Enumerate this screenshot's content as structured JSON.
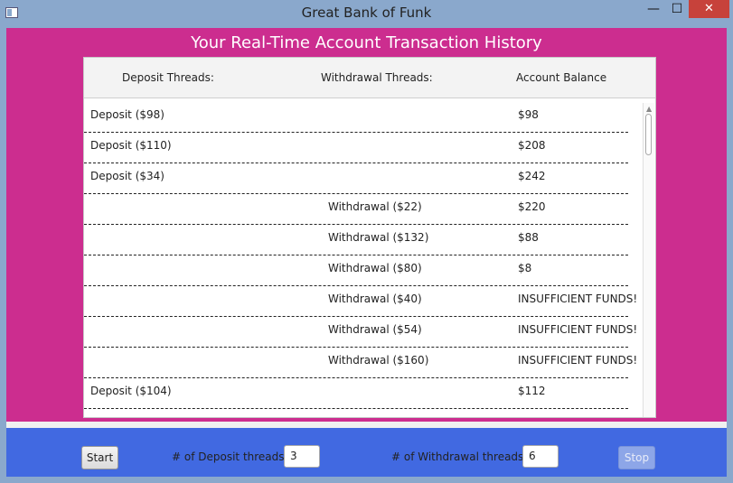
{
  "window": {
    "title": "Great Bank of Funk",
    "minimize": "—",
    "maximize": "☐",
    "close": "✕"
  },
  "heading": "Your Real-Time Account Transaction History",
  "table": {
    "columns": [
      "Deposit Threads:",
      "Withdrawal Threads:",
      "Account Balance"
    ],
    "rows": [
      {
        "deposit": "Deposit ($98)",
        "withdrawal": "",
        "balance": "$98"
      },
      {
        "deposit": "Deposit ($110)",
        "withdrawal": "",
        "balance": "$208"
      },
      {
        "deposit": "Deposit ($34)",
        "withdrawal": "",
        "balance": "$242"
      },
      {
        "deposit": "",
        "withdrawal": "Withdrawal ($22)",
        "balance": "$220"
      },
      {
        "deposit": "",
        "withdrawal": "Withdrawal ($132)",
        "balance": "$88"
      },
      {
        "deposit": "",
        "withdrawal": "Withdrawal ($80)",
        "balance": "$8"
      },
      {
        "deposit": "",
        "withdrawal": "Withdrawal ($40)",
        "balance": "INSUFFICIENT FUNDS!"
      },
      {
        "deposit": "",
        "withdrawal": "Withdrawal ($54)",
        "balance": "INSUFFICIENT FUNDS!"
      },
      {
        "deposit": "",
        "withdrawal": "Withdrawal ($160)",
        "balance": "INSUFFICIENT FUNDS!"
      },
      {
        "deposit": "Deposit ($104)",
        "withdrawal": "",
        "balance": "$112"
      }
    ]
  },
  "controls": {
    "start_label": "Start",
    "deposit_threads_label": "# of Deposit threads",
    "deposit_threads_value": "3",
    "withdrawal_threads_label": "# of Withdrawal threads",
    "withdrawal_threads_value": "6",
    "stop_label": "Stop"
  }
}
